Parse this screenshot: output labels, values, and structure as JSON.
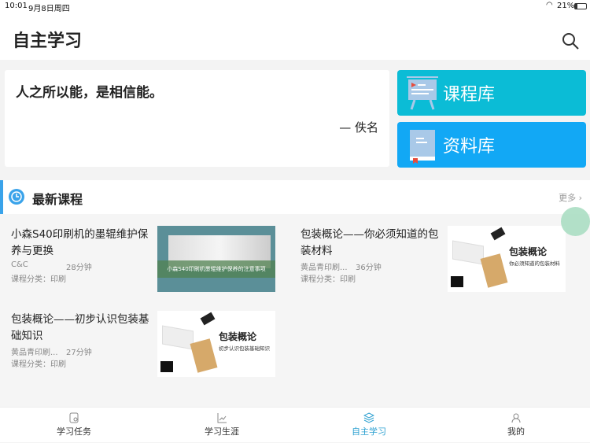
{
  "status": {
    "time": "10:01",
    "date": "9月8日周四",
    "battery": "21%"
  },
  "header": {
    "title": "自主学习"
  },
  "quote": {
    "text": "人之所以能，是相信能。",
    "author": "— 佚名"
  },
  "libraries": [
    {
      "label": "课程库",
      "color": "#0bbcd6"
    },
    {
      "label": "资料库",
      "color": "#12a8f5"
    }
  ],
  "section": {
    "title": "最新课程",
    "more": "更多"
  },
  "courses": [
    {
      "title": "小森S40印刷机的墨辊维护保养与更换",
      "author": "C&C",
      "duration": "28分钟",
      "category": "课程分类：印刷",
      "thumb_caption": "小森S40印刷机墨辊维护保养的注意事项"
    },
    {
      "title": "包装概论——你必须知道的包装材料",
      "author": "黄品青印刷...",
      "duration": "36分钟",
      "category": "课程分类：印刷",
      "thumb_title": "包装概论",
      "thumb_sub": "你必须知道的包装材料"
    },
    {
      "title": "包装概论——初步认识包装基础知识",
      "author": "黄品青印刷...",
      "duration": "27分钟",
      "category": "课程分类：印刷",
      "thumb_title": "包装概论",
      "thumb_sub": "初步认识包装基础知识"
    }
  ],
  "tabs": [
    {
      "label": "学习任务"
    },
    {
      "label": "学习生涯"
    },
    {
      "label": "自主学习",
      "active": true
    },
    {
      "label": "我的"
    }
  ]
}
